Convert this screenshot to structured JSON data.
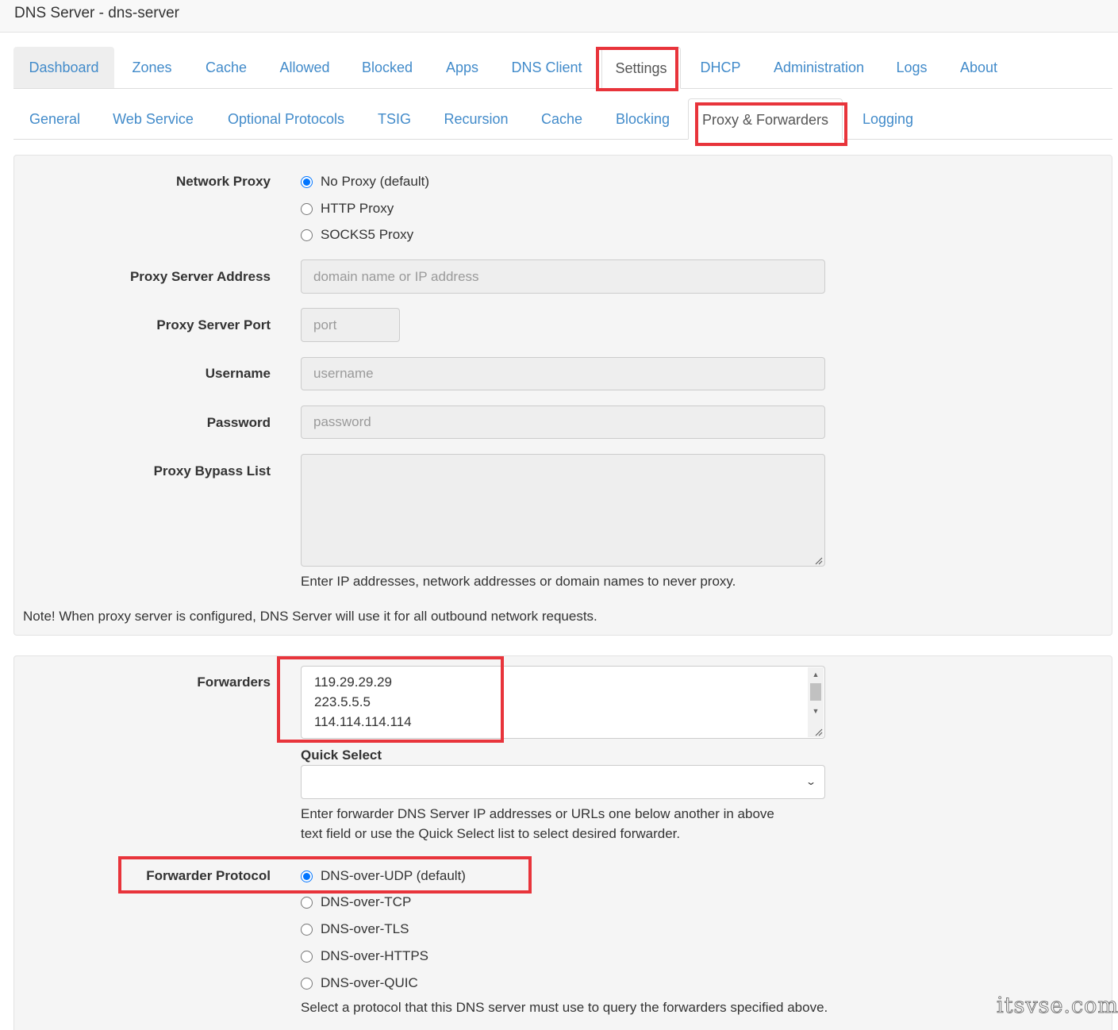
{
  "window": {
    "title": "DNS Server - dns-server"
  },
  "main_tabs": [
    "Dashboard",
    "Zones",
    "Cache",
    "Allowed",
    "Blocked",
    "Apps",
    "DNS Client",
    "Settings",
    "DHCP",
    "Administration",
    "Logs",
    "About"
  ],
  "sub_tabs": [
    "General",
    "Web Service",
    "Optional Protocols",
    "TSIG",
    "Recursion",
    "Cache",
    "Blocking",
    "Proxy & Forwarders",
    "Logging"
  ],
  "proxy": {
    "network_proxy_label": "Network Proxy",
    "options": [
      "No Proxy (default)",
      "HTTP Proxy",
      "SOCKS5 Proxy"
    ],
    "selected": "No Proxy (default)",
    "server_address_label": "Proxy Server Address",
    "server_address_placeholder": "domain name or IP address",
    "server_port_label": "Proxy Server Port",
    "server_port_placeholder": "port",
    "username_label": "Username",
    "username_placeholder": "username",
    "password_label": "Password",
    "password_placeholder": "password",
    "bypass_label": "Proxy Bypass List",
    "bypass_value": "",
    "bypass_help": "Enter IP addresses, network addresses or domain names to never proxy.",
    "note": "Note! When proxy server is configured, DNS Server will use it for all outbound network requests."
  },
  "forwarders": {
    "label": "Forwarders",
    "values": [
      "119.29.29.29",
      "223.5.5.5",
      "114.114.114.114"
    ],
    "quick_select_label": "Quick Select",
    "quick_select_value": "",
    "help_line1": "Enter forwarder DNS Server IP addresses or URLs one below another in above",
    "help_line2": "text field or use the Quick Select list to select desired forwarder.",
    "protocol_label": "Forwarder Protocol",
    "protocols": [
      "DNS-over-UDP (default)",
      "DNS-over-TCP",
      "DNS-over-TLS",
      "DNS-over-HTTPS",
      "DNS-over-QUIC"
    ],
    "selected_protocol": "DNS-over-UDP (default)",
    "protocol_help": "Select a protocol that this DNS server must use to query the forwarders specified above."
  },
  "watermark": "itsvse.com",
  "colors": {
    "link": "#428bca",
    "highlight": "#e8343b",
    "radio_selected": "#0075ff"
  }
}
